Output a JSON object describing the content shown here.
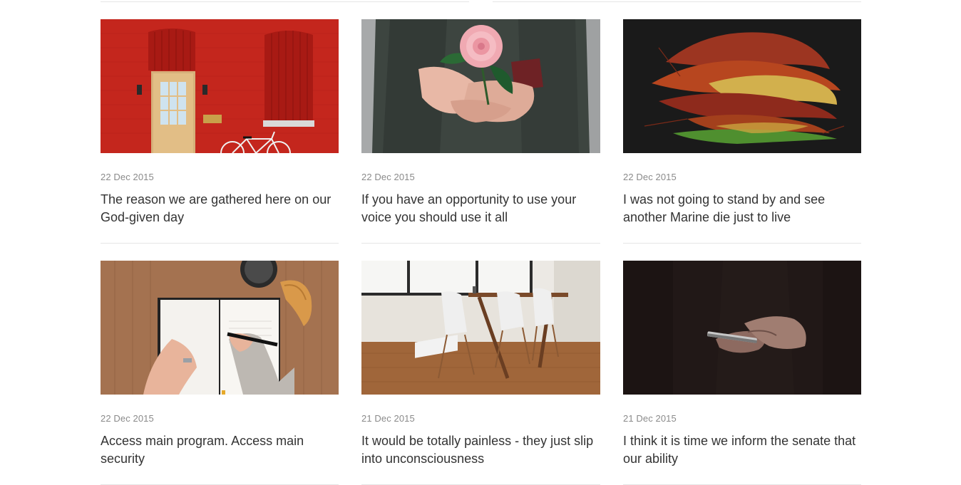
{
  "posts": [
    {
      "date": "22 Dec 2015",
      "title": "The reason we are gathered here on our God-given day",
      "image": "red-brick-house-with-bicycle"
    },
    {
      "date": "22 Dec 2015",
      "title": "If you have an opportunity to use your voice you should use it all",
      "image": "hands-holding-pink-flower"
    },
    {
      "date": "22 Dec 2015",
      "title": "I was not going to stand by and see another Marine die just to live",
      "image": "autumn-leaves-on-black"
    },
    {
      "date": "22 Dec 2015",
      "title": "Access main program. Access main security",
      "image": "hands-writing-in-notebook"
    },
    {
      "date": "21 Dec 2015",
      "title": "It would be totally painless - they just slip into unconsciousness",
      "image": "dining-table-with-chairs"
    },
    {
      "date": "21 Dec 2015",
      "title": "I think it is time we inform the senate that our ability",
      "image": "hands-holding-phone-dark"
    }
  ]
}
